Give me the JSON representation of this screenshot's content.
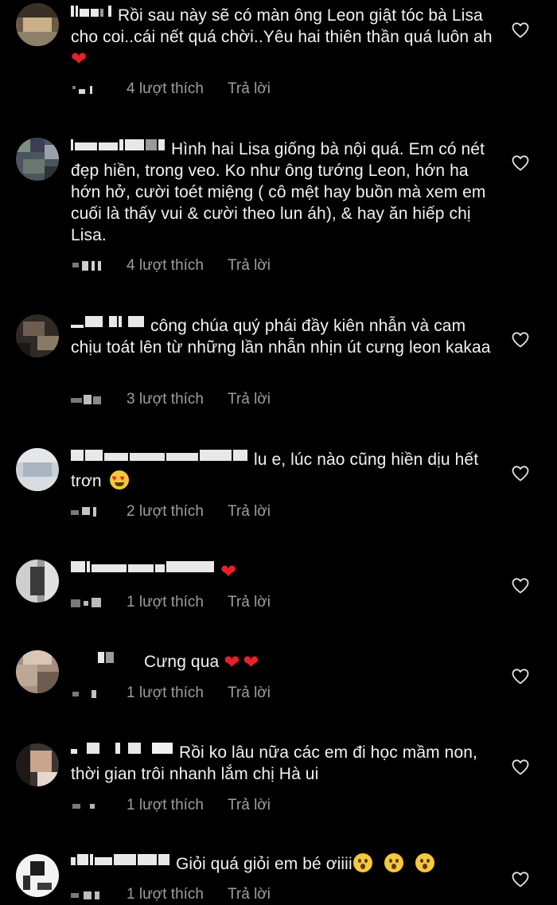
{
  "comments": [
    {
      "text": "Rồi sau này sẽ có màn ông Leon giật tóc bà Lisa cho coi..cái nết quá chời..Yêu hai thiên thần quá luôn ah",
      "emojis": [
        "red-heart"
      ],
      "likes": "4 lượt thích",
      "reply": "Trả lời"
    },
    {
      "text": "Hình hai Lisa giống bà nội quá. Em có nét đẹp hiền, trong veo. Ko như ông tướng Leon, hớn ha hớn hở, cười toét miệng ( cô mệt hay buồn mà xem em cuối là thấy vui & cười theo lun áh), & hay ăn hiếp chị Lisa.",
      "emojis": [],
      "likes": "4 lượt thích",
      "reply": "Trả lời"
    },
    {
      "text": "công chúa quý phái đầy kiên nhẫn và cam chịu toát lên từ những lần nhẫn nhịn út cưng leon kakaa",
      "emojis": [],
      "likes": "3 lượt thích",
      "reply": "Trả lời"
    },
    {
      "text": "lu e, lúc nào cũng hiền dịu hết trơn",
      "emojis": [
        "heart-eyes-face"
      ],
      "likes": "2 lượt thích",
      "reply": "Trả lời"
    },
    {
      "text": "",
      "emojis": [
        "red-heart"
      ],
      "likes": "1 lượt thích",
      "reply": "Trả lời"
    },
    {
      "text": "Cưng qua",
      "emojis": [
        "red-heart",
        "red-heart"
      ],
      "likes": "1 lượt thích",
      "reply": "Trả lời"
    },
    {
      "text": "Rồi ko lâu nữa các em đi học mầm non, thời gian trôi nhanh lắm chị Hà ui",
      "emojis": [],
      "likes": "1 lượt thích",
      "reply": "Trả lời"
    },
    {
      "text": "Giỏi quá giỏi em bé ơiiii",
      "emojis": [
        "hushed-face",
        "hushed-face",
        "hushed-face"
      ],
      "likes": "1 lượt thích",
      "reply": "Trả lời"
    }
  ],
  "colors": {
    "background": "#000000",
    "text": "#f2f2f2",
    "meta": "#9e9e9e",
    "heart_emoji": "#e8202a"
  }
}
